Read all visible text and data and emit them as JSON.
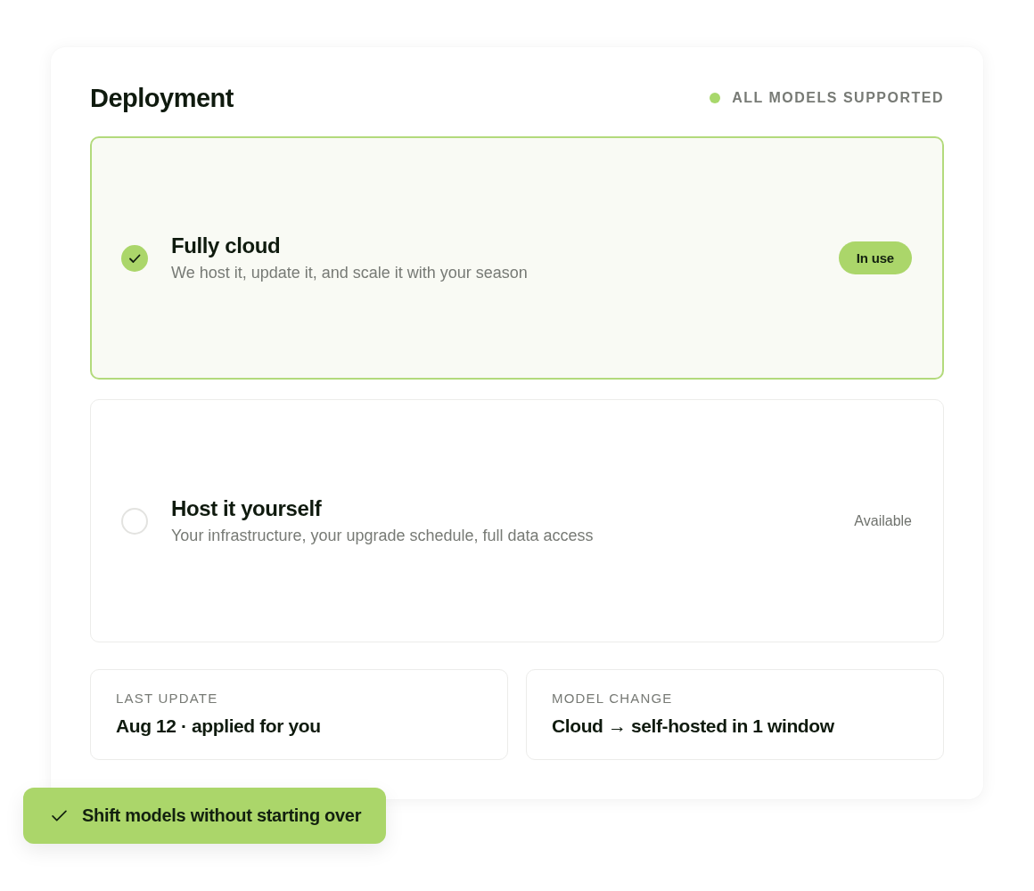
{
  "panel": {
    "title": "Deployment",
    "status": {
      "label": "ALL MODELS SUPPORTED",
      "color": "#a8d86b"
    }
  },
  "options": [
    {
      "title": "Fully cloud",
      "description": "We host it, update it, and scale it with your season",
      "selected": true,
      "tag": {
        "kind": "badge",
        "label": "In use"
      }
    },
    {
      "title": "Host it yourself",
      "description": "Your infrastructure, your upgrade schedule, full data access",
      "selected": false,
      "tag": {
        "kind": "text",
        "label": "Available"
      }
    }
  ],
  "facts": [
    {
      "label": "LAST UPDATE",
      "value": "Aug 12 · applied for you"
    },
    {
      "label": "MODEL CHANGE",
      "value": "Cloud → self-hosted in 1 window"
    }
  ],
  "toast": {
    "label": "Shift models without starting over"
  }
}
